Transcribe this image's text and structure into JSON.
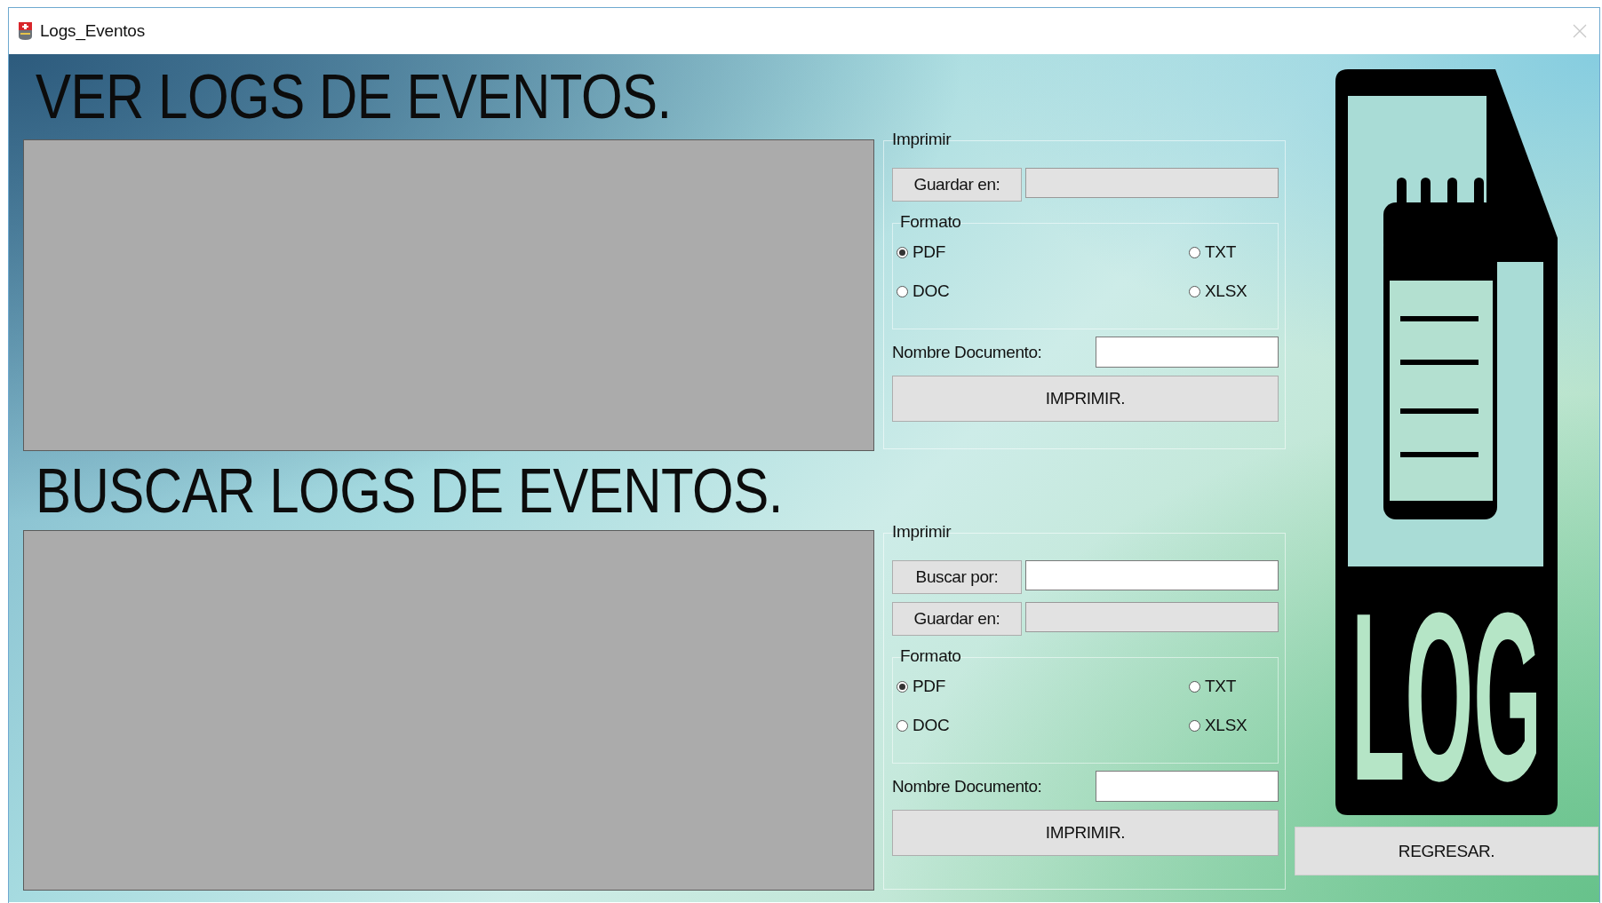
{
  "window": {
    "title": "Logs_Eventos"
  },
  "view_section": {
    "heading": "VER LOGS DE EVENTOS.",
    "print_panel": {
      "title": "Imprimir",
      "actions": [
        {
          "button": "Guardar en:",
          "field_disabled": true
        }
      ],
      "format": {
        "title": "Formato",
        "options": [
          {
            "label": "PDF",
            "selected": true
          },
          {
            "label": "TXT",
            "selected": false
          },
          {
            "label": "DOC",
            "selected": false
          },
          {
            "label": "XLSX",
            "selected": false
          }
        ]
      },
      "name_label": "Nombre Documento:",
      "print_button": "IMPRIMIR."
    }
  },
  "search_section": {
    "heading": "BUSCAR LOGS DE EVENTOS.",
    "print_panel": {
      "title": "Imprimir",
      "actions": [
        {
          "button": "Buscar por:",
          "field_disabled": false
        },
        {
          "button": "Guardar en:",
          "field_disabled": true
        }
      ],
      "format": {
        "title": "Formato",
        "options": [
          {
            "label": "PDF",
            "selected": true
          },
          {
            "label": "TXT",
            "selected": false
          },
          {
            "label": "DOC",
            "selected": false
          },
          {
            "label": "XLSX",
            "selected": false
          }
        ]
      },
      "name_label": "Nombre Documento:",
      "print_button": "IMPRIMIR."
    }
  },
  "logo": {
    "text": "LOG"
  },
  "back_button": "REGRESAR."
}
